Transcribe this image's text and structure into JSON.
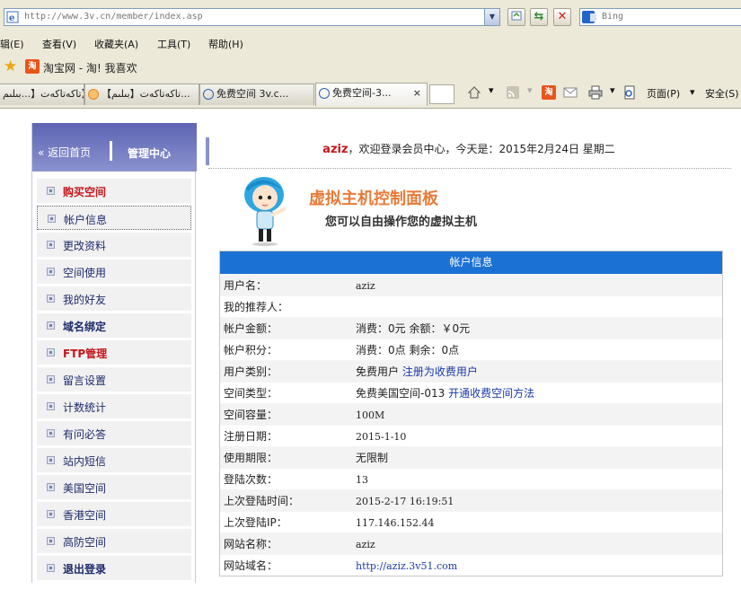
{
  "browser": {
    "url": "http://www.3v.cn/member/index.asp",
    "search_placeholder": "Bing",
    "menu": [
      "辑(E)",
      "查看(V)",
      "收藏夹(A)",
      "工具(T)",
      "帮助(H)"
    ],
    "favorite_label": "淘宝网 - 淘! 我喜欢",
    "favorite_icon_text": "淘",
    "tabs": [
      {
        "label": "ئا【تاکەتاکەت【...بىلىم"
      },
      {
        "label": "【تاکەتاکەت【بىلىم..."
      },
      {
        "label": "免费空间 3v.c..."
      },
      {
        "label": "免费空间-3..."
      }
    ],
    "page_menu": "页面(P)",
    "safety_menu": "安全(S)"
  },
  "sidebar": {
    "back_label": "返回首页",
    "center_label": "管理中心",
    "items": [
      {
        "label": "购买空间"
      },
      {
        "label": "帐户信息"
      },
      {
        "label": "更改资料"
      },
      {
        "label": "空间使用"
      },
      {
        "label": "我的好友"
      },
      {
        "label": "域名绑定"
      },
      {
        "label": "FTP管理"
      },
      {
        "label": "留言设置"
      },
      {
        "label": "计数统计"
      },
      {
        "label": "有问必答"
      },
      {
        "label": "站内短信"
      },
      {
        "label": "美国空间"
      },
      {
        "label": "香港空间"
      },
      {
        "label": "高防空间"
      },
      {
        "label": "退出登录"
      }
    ]
  },
  "welcome": {
    "username": "aziz",
    "text": "，欢迎登录会员中心，今天是：2015年2月24日 星期二"
  },
  "panel": {
    "title": "虚拟主机控制面板",
    "subtitle": "您可以自由操作您的虚拟主机"
  },
  "account": {
    "header": "帐户信息",
    "rows": [
      {
        "key": "用户名：",
        "value": "aziz"
      },
      {
        "key": "我的推荐人：",
        "value": ""
      },
      {
        "key": "帐户金额：",
        "value": "消费：0元 余额：￥0元"
      },
      {
        "key": "帐户积分：",
        "value": "消费：0点 剩余：0点"
      },
      {
        "key": "用户类别：",
        "value": "免费用户",
        "link": "注册为收费用户"
      },
      {
        "key": "空间类型：",
        "value": "免费美国空间-013",
        "link": "开通收费空间方法"
      },
      {
        "key": "空间容量：",
        "value": "100M"
      },
      {
        "key": "注册日期：",
        "value": "2015-1-10"
      },
      {
        "key": "使用期限：",
        "value": "无限制"
      },
      {
        "key": "登陆次数：",
        "value": "13"
      },
      {
        "key": "上次登陆时间：",
        "value": "2015-2-17 16:19:51"
      },
      {
        "key": "上次登陆IP：",
        "value": "117.146.152.44"
      },
      {
        "key": "网站名称：",
        "value": "aziz"
      },
      {
        "key": "网站域名：",
        "value": "http://aziz.3v51.com"
      }
    ]
  }
}
